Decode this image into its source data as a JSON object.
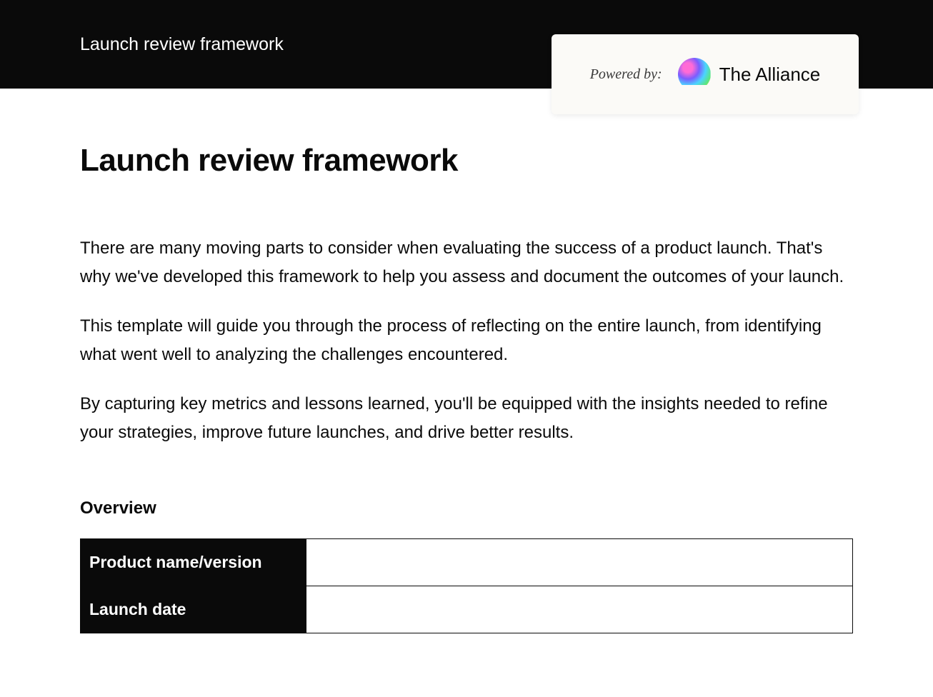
{
  "header": {
    "title": "Launch review framework"
  },
  "powered_by": {
    "label": "Powered by:",
    "brand_name": "The Alliance"
  },
  "page": {
    "title": "Launch review framework",
    "paragraphs": [
      "There are many moving parts to consider when evaluating the success of a product launch. That's why we've developed this framework to help you assess and document the outcomes of your launch.",
      "This template will guide you through the process of reflecting on the entire launch, from identifying what went well to analyzing the challenges encountered.",
      "By capturing key metrics and lessons learned, you'll be equipped with the insights needed to refine your strategies, improve future launches, and drive better results."
    ]
  },
  "overview": {
    "heading": "Overview",
    "rows": [
      {
        "label": "Product name/version",
        "value": ""
      },
      {
        "label": "Launch date",
        "value": ""
      }
    ]
  }
}
